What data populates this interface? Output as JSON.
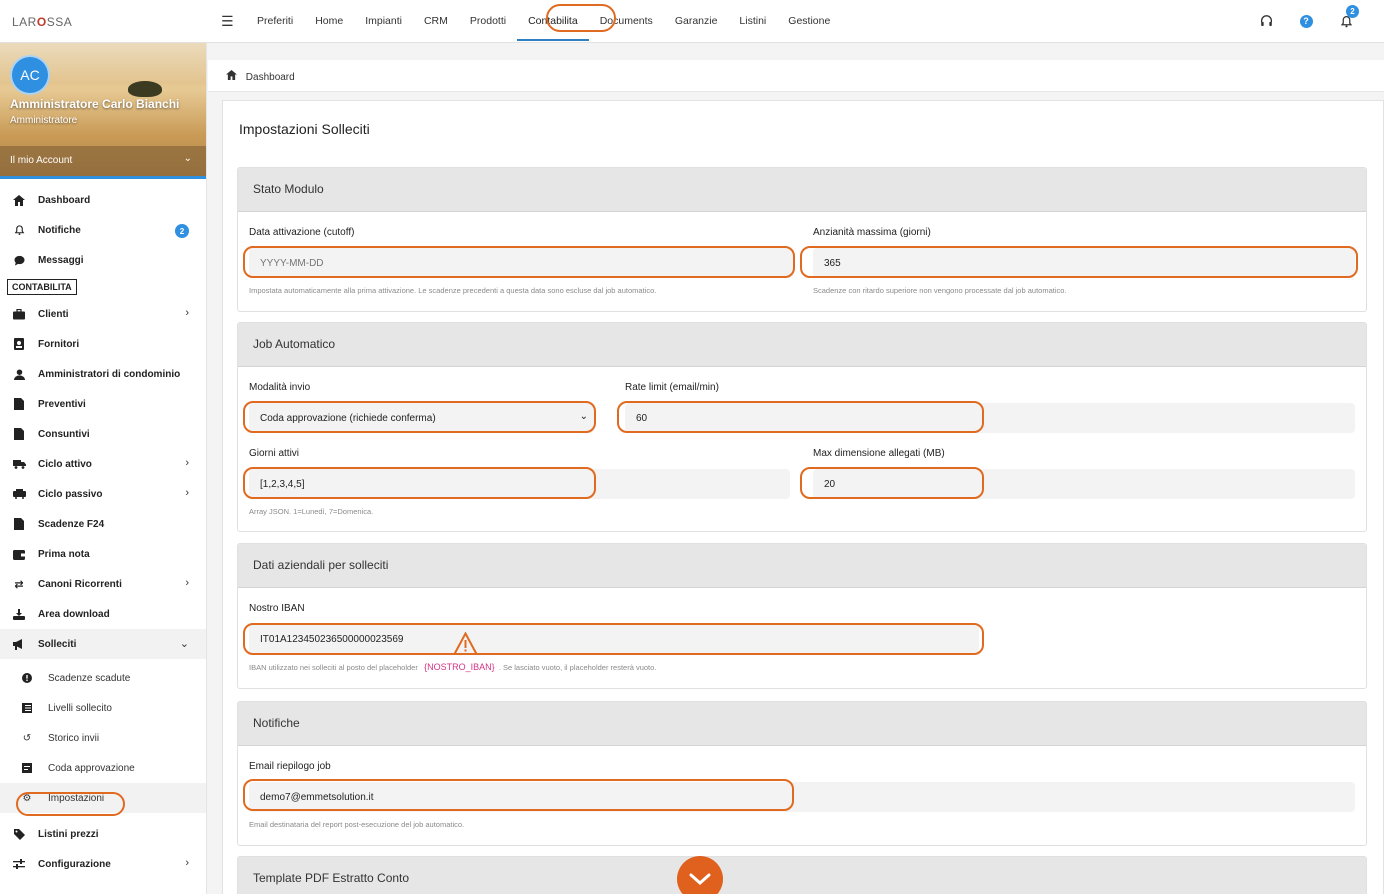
{
  "topbar": {
    "logo_text_a": "LAR",
    "logo_text_b": "O",
    "logo_text_c": "SSA",
    "menu_icon": "hamburger-icon",
    "nav": [
      "Preferiti",
      "Home",
      "Impianti",
      "CRM",
      "Prodotti",
      "Contabilita",
      "Documents",
      "Garanzie",
      "Listini",
      "Gestione"
    ],
    "active_nav": "Contabilita",
    "help_label": "?",
    "notification_count": "2"
  },
  "profile": {
    "initials": "AC",
    "name": "Amministratore Carlo Bianchi",
    "role": "Amministratore",
    "account_label": "Il mio Account"
  },
  "sidebar": {
    "top_items": [
      {
        "label": "Dashboard",
        "icon": "home-icon"
      },
      {
        "label": "Notifiche",
        "icon": "bell-icon",
        "badge": "2"
      },
      {
        "label": "Messaggi",
        "icon": "chat-icon"
      }
    ],
    "section_label": "CONTABILITA",
    "items": [
      {
        "label": "Clienti",
        "icon": "briefcase-icon",
        "arrow": true
      },
      {
        "label": "Fornitori",
        "icon": "id-card-icon"
      },
      {
        "label": "Amministratori di condominio",
        "icon": "user-icon"
      },
      {
        "label": "Preventivi",
        "icon": "file-icon"
      },
      {
        "label": "Consuntivi",
        "icon": "file-icon"
      },
      {
        "label": "Ciclo attivo",
        "icon": "truck-icon",
        "arrow": true
      },
      {
        "label": "Ciclo passivo",
        "icon": "cart-icon",
        "arrow": true
      },
      {
        "label": "Scadenze F24",
        "icon": "document-icon"
      },
      {
        "label": "Prima nota",
        "icon": "wallet-icon"
      },
      {
        "label": "Canoni Ricorrenti",
        "icon": "repeat-icon",
        "arrow": true
      },
      {
        "label": "Area download",
        "icon": "download-icon"
      }
    ],
    "open_item": {
      "label": "Solleciti",
      "icon": "megaphone-icon"
    },
    "sub_items": [
      {
        "label": "Scadenze scadute",
        "icon": "alert-circle-icon"
      },
      {
        "label": "Livelli sollecito",
        "icon": "list-icon"
      },
      {
        "label": "Storico invii",
        "icon": "history-icon"
      },
      {
        "label": "Coda approvazione",
        "icon": "queue-icon"
      },
      {
        "label": "Impostazioni",
        "icon": "gear-icon"
      }
    ],
    "bottom_items": [
      {
        "label": "Listini prezzi",
        "icon": "tag-icon"
      },
      {
        "label": "Configurazione",
        "icon": "sliders-icon",
        "arrow": true
      }
    ]
  },
  "breadcrumb": {
    "label": "Dashboard"
  },
  "page": {
    "title": "Impostazioni Solleciti",
    "stato": {
      "heading": "Stato Modulo",
      "cutoff_label": "Data attivazione (cutoff)",
      "cutoff_placeholder": "YYYY-MM-DD",
      "cutoff_help": "Impostata automaticamente alla prima attivazione. Le scadenze precedenti a questa data sono escluse dal job automatico.",
      "max_age_label": "Anzianità massima (giorni)",
      "max_age_value": "365",
      "max_age_help": "Scadenze con ritardo superiore non vengono processate dal job automatico."
    },
    "job": {
      "heading": "Job Automatico",
      "mode_label": "Modalità invio",
      "mode_value": "Coda approvazione (richiede conferma)",
      "rate_label": "Rate limit (email/min)",
      "rate_value": "60",
      "days_label": "Giorni attivi",
      "days_value": "[1,2,3,4,5]",
      "days_help": "Array JSON. 1=Lunedì, 7=Domenica.",
      "attach_label": "Max dimensione allegati (MB)",
      "attach_value": "20"
    },
    "company": {
      "heading": "Dati aziendali per solleciti",
      "iban_label": "Nostro IBAN",
      "iban_value": "IT01A1234502365000000235​69",
      "iban_help_a": "IBAN utilizzato nei solleciti al posto del placeholder",
      "iban_help_code": "{NOSTRO_IBAN}",
      "iban_help_b": ". Se lasciato vuoto, il placeholder resterà vuoto."
    },
    "notifications": {
      "heading": "Notifiche",
      "email_label": "Email riepilogo job",
      "email_value": "demo7@emmetsolution.it",
      "email_help": "Email destinataria del report post-esecuzione del job automatico."
    },
    "template": {
      "heading": "Template PDF Estratto Conto"
    }
  },
  "colors": {
    "accent": "#2f8fe0",
    "highlight_ring": "#e06a1f",
    "scroll_button": "#e0601d"
  }
}
